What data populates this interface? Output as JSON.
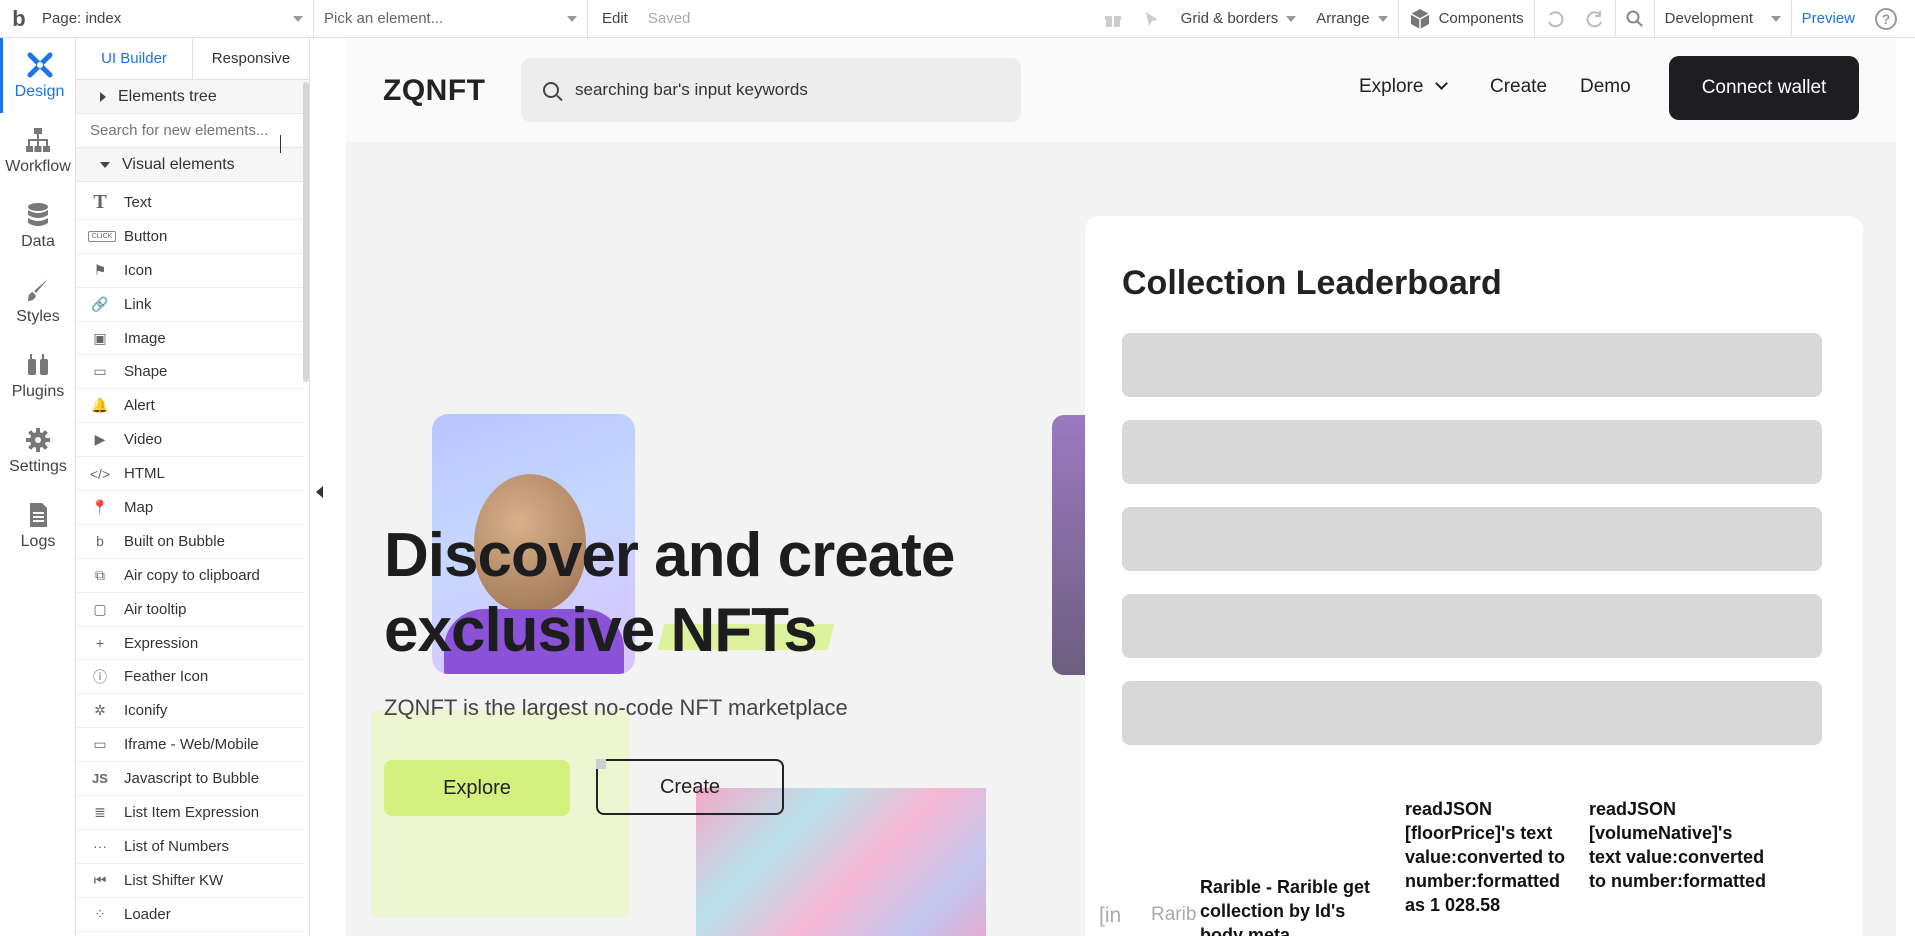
{
  "topbar": {
    "logo": "b",
    "page_label": "Page: index",
    "pick_element": "Pick an element...",
    "edit": "Edit",
    "saved": "Saved",
    "grid": "Grid & borders",
    "arrange": "Arrange",
    "components": "Components",
    "environment": "Development",
    "preview": "Preview",
    "help": "?"
  },
  "leftnav": [
    {
      "label": "Design",
      "icon": "design-icon",
      "active": true
    },
    {
      "label": "Workflow",
      "icon": "workflow-icon"
    },
    {
      "label": "Data",
      "icon": "data-icon"
    },
    {
      "label": "Styles",
      "icon": "styles-icon"
    },
    {
      "label": "Plugins",
      "icon": "plugins-icon"
    },
    {
      "label": "Settings",
      "icon": "settings-icon"
    },
    {
      "label": "Logs",
      "icon": "logs-icon"
    }
  ],
  "palette": {
    "tabs": [
      "UI Builder",
      "Responsive"
    ],
    "elements_tree": "Elements tree",
    "search_placeholder": "Search for new elements...",
    "visual_elements": "Visual elements",
    "items": [
      {
        "label": "Text",
        "icon": "T"
      },
      {
        "label": "Button",
        "icon": "CLICK"
      },
      {
        "label": "Icon",
        "icon": "⚑"
      },
      {
        "label": "Link",
        "icon": "🔗"
      },
      {
        "label": "Image",
        "icon": "▣"
      },
      {
        "label": "Shape",
        "icon": "▭"
      },
      {
        "label": "Alert",
        "icon": "🔔"
      },
      {
        "label": "Video",
        "icon": "▶"
      },
      {
        "label": "HTML",
        "icon": "</>"
      },
      {
        "label": "Map",
        "icon": "📍"
      },
      {
        "label": "Built on Bubble",
        "icon": "b"
      },
      {
        "label": "Air copy to clipboard",
        "icon": "⧉"
      },
      {
        "label": "Air tooltip",
        "icon": "▢"
      },
      {
        "label": "Expression",
        "icon": "+"
      },
      {
        "label": "Feather Icon",
        "icon": "ⓘ"
      },
      {
        "label": "Iconify",
        "icon": "✲"
      },
      {
        "label": "Iframe - Web/Mobile",
        "icon": "▭"
      },
      {
        "label": "Javascript to Bubble",
        "icon": "JS"
      },
      {
        "label": "List Item Expression",
        "icon": "≣"
      },
      {
        "label": "List of Numbers",
        "icon": "···"
      },
      {
        "label": "List Shifter KW",
        "icon": "⏮"
      },
      {
        "label": "Loader",
        "icon": "⁘"
      }
    ]
  },
  "site": {
    "logo": "ZQNFT",
    "search_text": "searching bar's input keywords",
    "nav": {
      "explore": "Explore",
      "create": "Create",
      "demo": "Demo"
    },
    "connect": "Connect wallet",
    "hero_title": "Discover and create exclusive NFTs",
    "hero_sub": "ZQNFT is the largest no-code NFT marketplace",
    "btn_explore": "Explore",
    "btn_create": "Create",
    "leaderboard_title": "Collection Leaderboard",
    "table": {
      "c1": "[in",
      "c2": "Rarib",
      "c3": "Rarible - Rarible get collection by Id's body meta",
      "c4": "readJSON [floorPrice]'s text value:converted to number:formatted as 1 028.58",
      "c5": "readJSON [volumeNative]'s text value:converted to number:formatted"
    }
  },
  "colors": {
    "accent": "#1a73e8",
    "lime": "#d4f07f",
    "dark": "#1e1e22"
  }
}
